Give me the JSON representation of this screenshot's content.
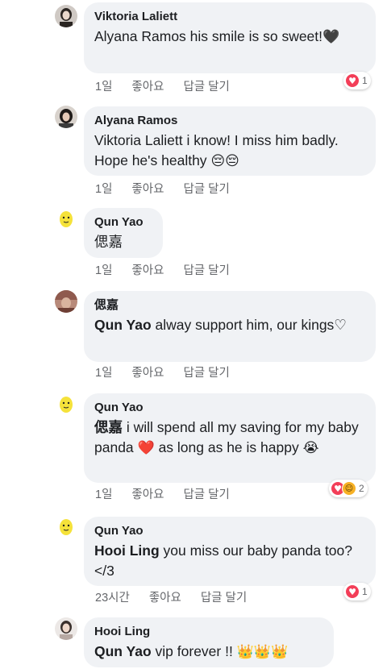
{
  "actions": {
    "like": "좋아요",
    "reply": "답글 달기"
  },
  "comments": [
    {
      "author": "Viktoria Laliett",
      "mention": "",
      "text": "Alyana Ramos his smile is so sweet!",
      "emoji": "🖤",
      "time": "1일",
      "reaction_count": "1"
    },
    {
      "author": "Alyana Ramos",
      "mention": "",
      "text": "Viktoria Laliett i know! I miss him badly. Hope he's healthy",
      "emoji": "😔😔",
      "time": "1일"
    },
    {
      "author": "Qun Yao",
      "mention": "",
      "text": "偲嘉",
      "time": "1일"
    },
    {
      "author": "偲嘉",
      "mention": "Qun Yao",
      "text": " alway support him, our kings♡",
      "time": "1일"
    },
    {
      "author": "Qun Yao",
      "mention": "偲嘉",
      "text": " i will spend all my saving for my baby panda ",
      "emoji_mid": "❤️",
      "text2": " as long as he is happy ",
      "emoji": "😭",
      "time": "1일",
      "reaction_count": "2"
    },
    {
      "author": "Qun Yao",
      "mention": "Hooi Ling",
      "text": " you miss our baby panda too? </3",
      "time": "23시간",
      "reaction_count": "1"
    },
    {
      "author": "Hooi Ling",
      "mention": "Qun Yao",
      "text": "  vip forever !! ",
      "emoji": "👑👑👑"
    }
  ],
  "colors": {
    "bubble": "#f0f2f5",
    "meta": "#65676b",
    "heart_reaction": "#f33e58",
    "haha_reaction": "#f7b125"
  },
  "icons": {
    "reaction_heart": "heart-icon",
    "reaction_haha": "haha-icon"
  }
}
